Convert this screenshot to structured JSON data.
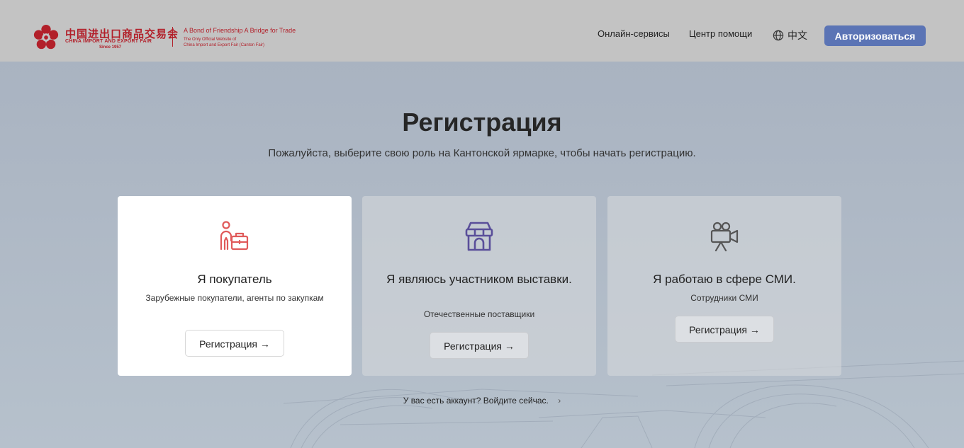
{
  "header": {
    "logo": {
      "cn_name": "中国进出口商品交易会",
      "en_name": "CHINA IMPORT AND EXPORT FAIR",
      "since": "Since 1957",
      "slogan": "A Bond of Friendship  A Bridge for Trade",
      "official_line1": "The Only Official Website of",
      "official_line2": "China Import and Export Fair (Canton Fair)"
    },
    "nav_online": "Онлайн-сервисы",
    "nav_help": "Центр помощи",
    "lang": "中文",
    "login_button": "Авторизоваться"
  },
  "main": {
    "title": "Регистрация",
    "subtitle": "Пожалуйста, выберите свою роль на Кантонской ярмарке, чтобы начать регистрацию.",
    "cards": [
      {
        "icon": "buyer-icon",
        "title": "Я покупатель",
        "desc": "Зарубежные покупатели, агенты по закупкам",
        "button": "Регистрация →",
        "icon_color": "#e05a5a"
      },
      {
        "icon": "store-icon",
        "title": "Я являюсь участником выставки.",
        "desc": "Отечественные поставщики",
        "button": "Регистрация →",
        "icon_color": "#5a4f9a"
      },
      {
        "icon": "video-camera-icon",
        "title": "Я работаю в сфере СМИ.",
        "desc": "Сотрудники СМИ",
        "button": "Регистрация →",
        "icon_color": "#555555"
      }
    ],
    "login_hint": "У вас есть аккаунт? Войдите сейчас."
  },
  "colors": {
    "brand_red": "#b2202a",
    "primary_button": "#5b74b5"
  }
}
